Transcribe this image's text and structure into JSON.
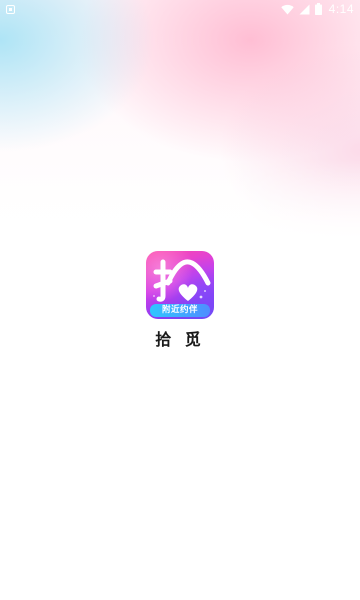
{
  "status_bar": {
    "time": "4:14",
    "icons": [
      "notification-icon",
      "wifi-icon",
      "signal-icon",
      "battery-icon"
    ]
  },
  "splash": {
    "app_icon": {
      "name": "app-logo-icon",
      "banner_text": "附近约伴",
      "colors": {
        "gradient_start": "#ff49a8",
        "gradient_mid": "#d43ee8",
        "gradient_end": "#6a4cf5",
        "banner": "#2fc6ff"
      }
    },
    "app_name": "拾 觅"
  }
}
